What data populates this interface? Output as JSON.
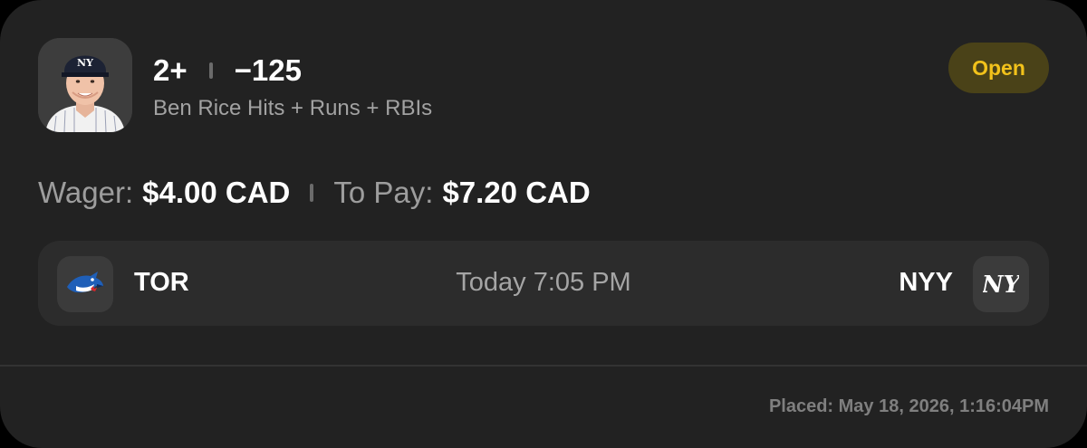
{
  "bet": {
    "line": "2+",
    "odds": "−125",
    "market": "Ben Rice Hits + Runs + RBIs",
    "status": "Open",
    "player_image_icon": "player-headshot-icon"
  },
  "wager": {
    "wager_label": "Wager:",
    "wager_value": "$4.00 CAD",
    "payout_label": "To Pay:",
    "payout_value": "$7.20 CAD"
  },
  "game": {
    "home_team": "TOR",
    "home_logo_icon": "blue-jays-logo-icon",
    "time": "Today 7:05 PM",
    "away_team": "NYY",
    "away_logo_icon": "yankees-logo-icon"
  },
  "footer": {
    "placed": "Placed: May 18, 2026, 1:16:04PM"
  },
  "colors": {
    "card_bg": "#222222",
    "status_text": "#f2c21b",
    "status_bg": "#4a4218"
  }
}
